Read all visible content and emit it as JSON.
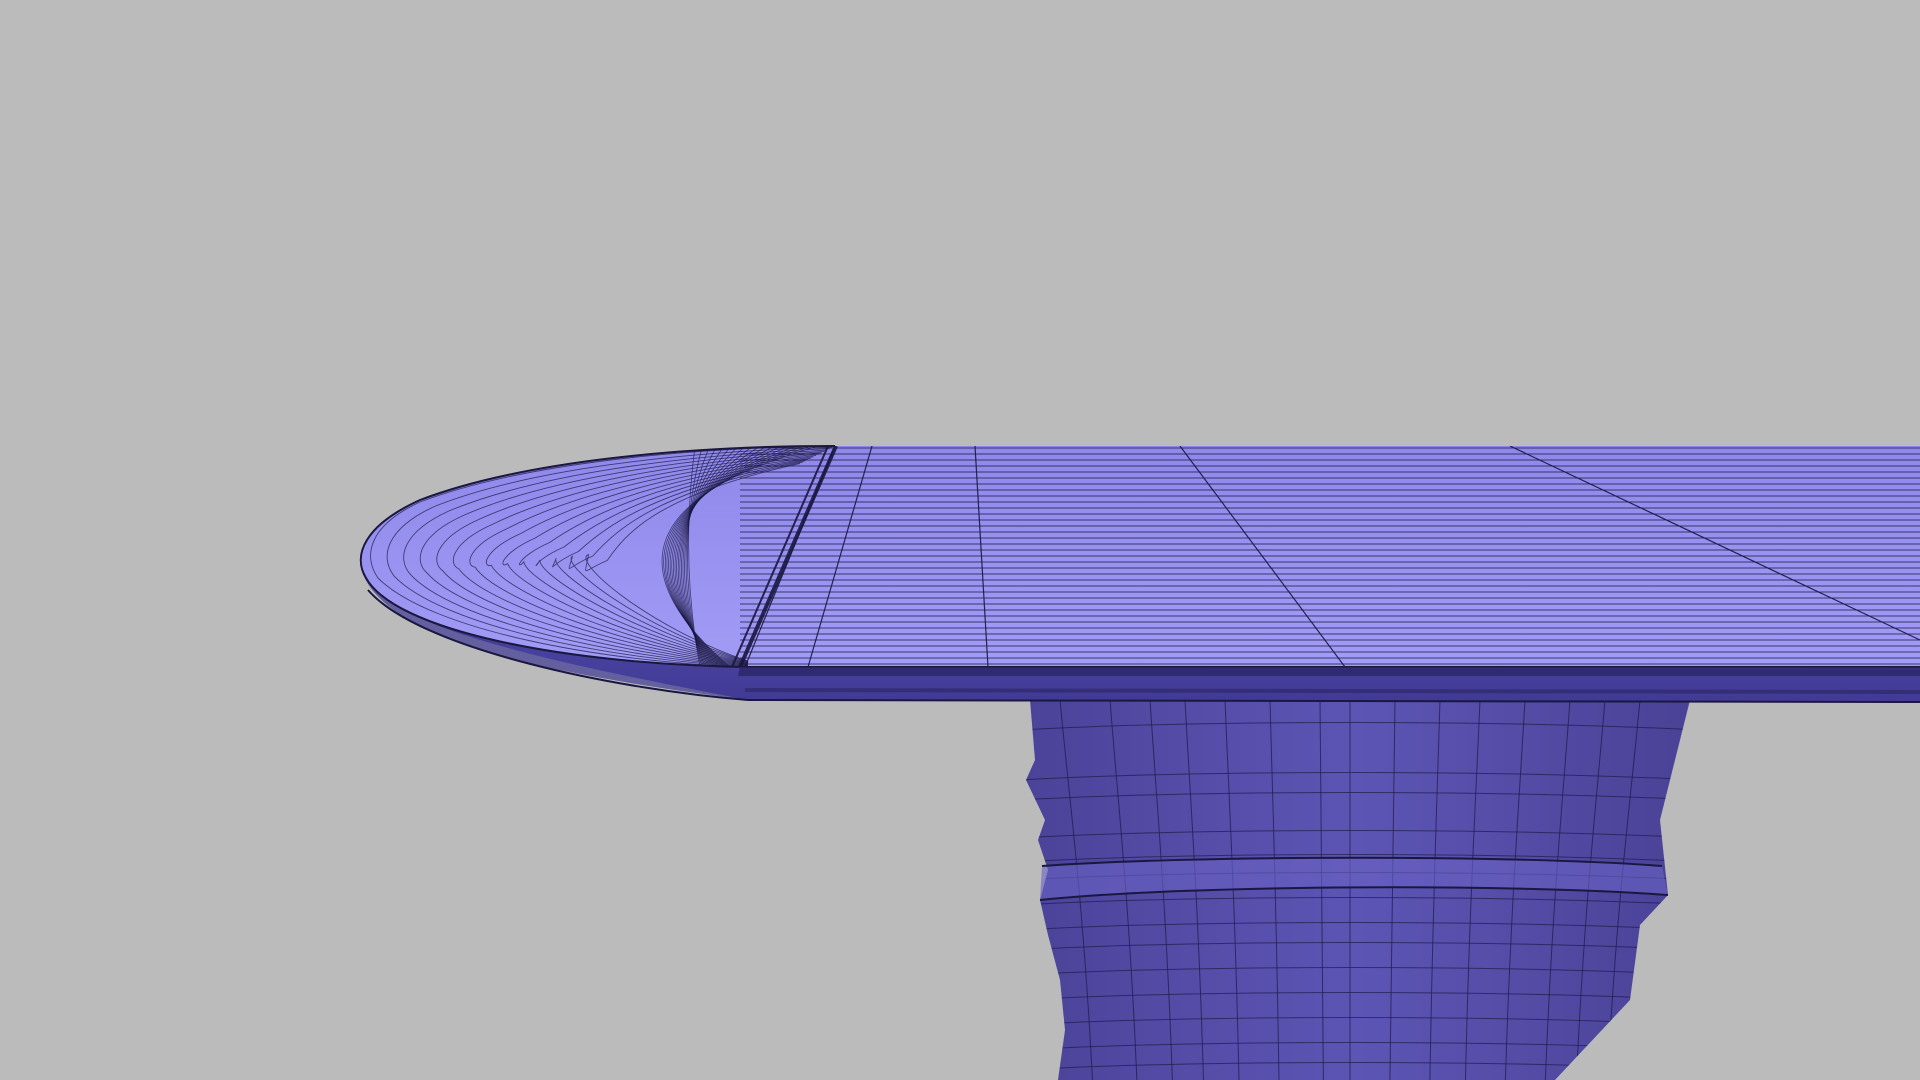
{
  "scene": {
    "background_color": "#bbbbbb",
    "subject": "table-mesh",
    "shading": "wireframe-on-shaded",
    "colors": {
      "top_light": "#9b94f2",
      "top_mid": "#8f88ea",
      "edge_band": "#5c55b5",
      "edge_dark": "#2c2768",
      "pedestal": "#5a51b0",
      "pedestal_dark": "#443c92",
      "wire": "#1a1740"
    }
  }
}
